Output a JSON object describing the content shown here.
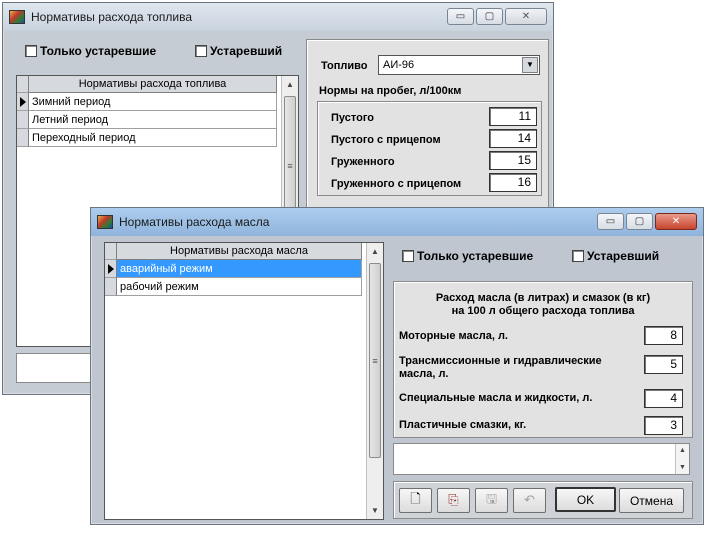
{
  "fuel_window": {
    "title": "Нормативы расхода топлива",
    "controls": {
      "minimize": "▭",
      "maximize": "▢",
      "close": "✕"
    },
    "only_outdated_label": "Только устаревшие",
    "outdated_label": "Устаревший",
    "grid": {
      "header": "Нормативы расхода топлива",
      "rows": [
        "Зимний период",
        "Летний период",
        "Переходный период"
      ]
    },
    "fuel_label": "Топливо",
    "fuel_value": "АИ-96",
    "norms_title": "Нормы на пробег, л/100км",
    "norms": [
      {
        "label": "Пустого",
        "value": "11"
      },
      {
        "label": "Пустого с прицепом",
        "value": "14"
      },
      {
        "label": "Груженного",
        "value": "15"
      },
      {
        "label": "Груженного с прицепом",
        "value": "16"
      }
    ]
  },
  "oil_window": {
    "title": "Нормативы расхода масла",
    "controls": {
      "minimize": "▭",
      "maximize": "▢",
      "close": "✕"
    },
    "only_outdated_label": "Только устаревшие",
    "outdated_label": "Устаревший",
    "grid": {
      "header": "Нормативы расхода масла",
      "rows": [
        "аварийный режим",
        "рабочий режим"
      ]
    },
    "rates_title_line1": "Расход масла (в литрах) и смазок (в кг)",
    "rates_title_line2": "на 100 л общего расхода топлива",
    "rates": [
      {
        "label": "Моторные масла, л.",
        "value": "8"
      },
      {
        "label_line1": "Трансмиссионные и гидравлические",
        "label_line2": "масла, л.",
        "value": "5"
      },
      {
        "label": "Специальные масла и жидкости, л.",
        "value": "4"
      },
      {
        "label": "Пластичные смазки, кг.",
        "value": "3"
      }
    ],
    "ok_label": "OK",
    "cancel_label": "Отмена"
  },
  "icons": {
    "new": "new-document-icon",
    "copy": "copy-document-icon",
    "save": "save-icon",
    "undo": "undo-icon"
  }
}
